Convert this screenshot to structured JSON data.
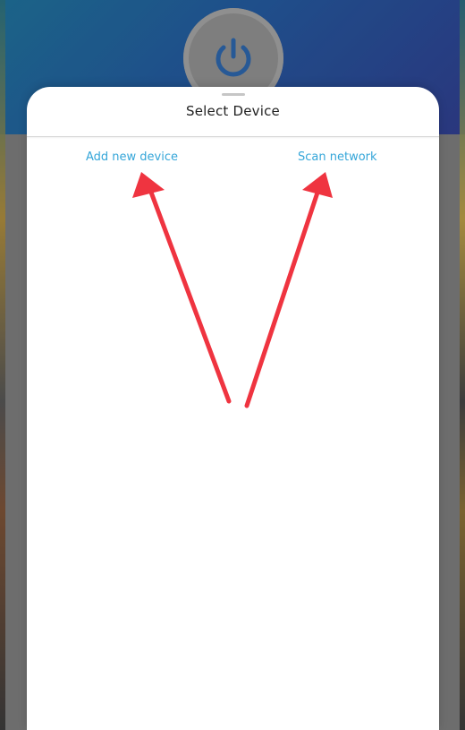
{
  "background": {
    "power_icon": "power-icon",
    "header_gradient": [
      "#1f6f98",
      "#2f3d8c"
    ]
  },
  "sheet": {
    "title": "Select Device",
    "actions": {
      "add_new_device": "Add new device",
      "scan_network": "Scan network"
    }
  },
  "colors": {
    "link": "#35a6d9",
    "annotation_arrow": "#ef3440",
    "sheet_bg": "#ffffff"
  }
}
